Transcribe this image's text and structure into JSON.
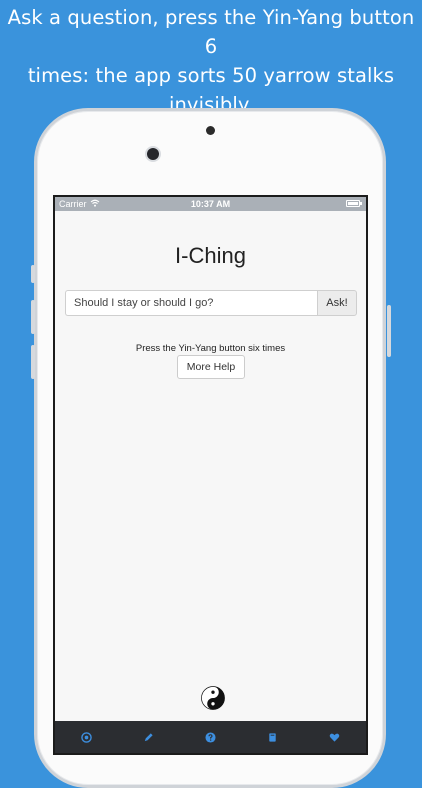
{
  "caption": {
    "line1": "Ask a question, press the Yin-Yang button 6",
    "line2": "times: the app sorts 50 yarrow stalks",
    "line3": "invisibly."
  },
  "colors": {
    "background": "#3a93dc",
    "tab_bar": "#2b2d31",
    "tab_icon": "#3d8fe0"
  },
  "status_bar": {
    "carrier": "Carrier",
    "time": "10:37 AM"
  },
  "app": {
    "title": "I-Ching",
    "question": {
      "value": "Should I stay or should I go?",
      "ask_label": "Ask!"
    },
    "instruction": "Press the Yin-Yang button six times",
    "more_help_label": "More Help",
    "yin_yang_icon": "yin-yang-icon"
  },
  "tab_bar": {
    "tabs": [
      {
        "icon": "target-icon"
      },
      {
        "icon": "pencil-icon"
      },
      {
        "icon": "question-icon"
      },
      {
        "icon": "book-icon"
      },
      {
        "icon": "heart-icon"
      }
    ]
  }
}
